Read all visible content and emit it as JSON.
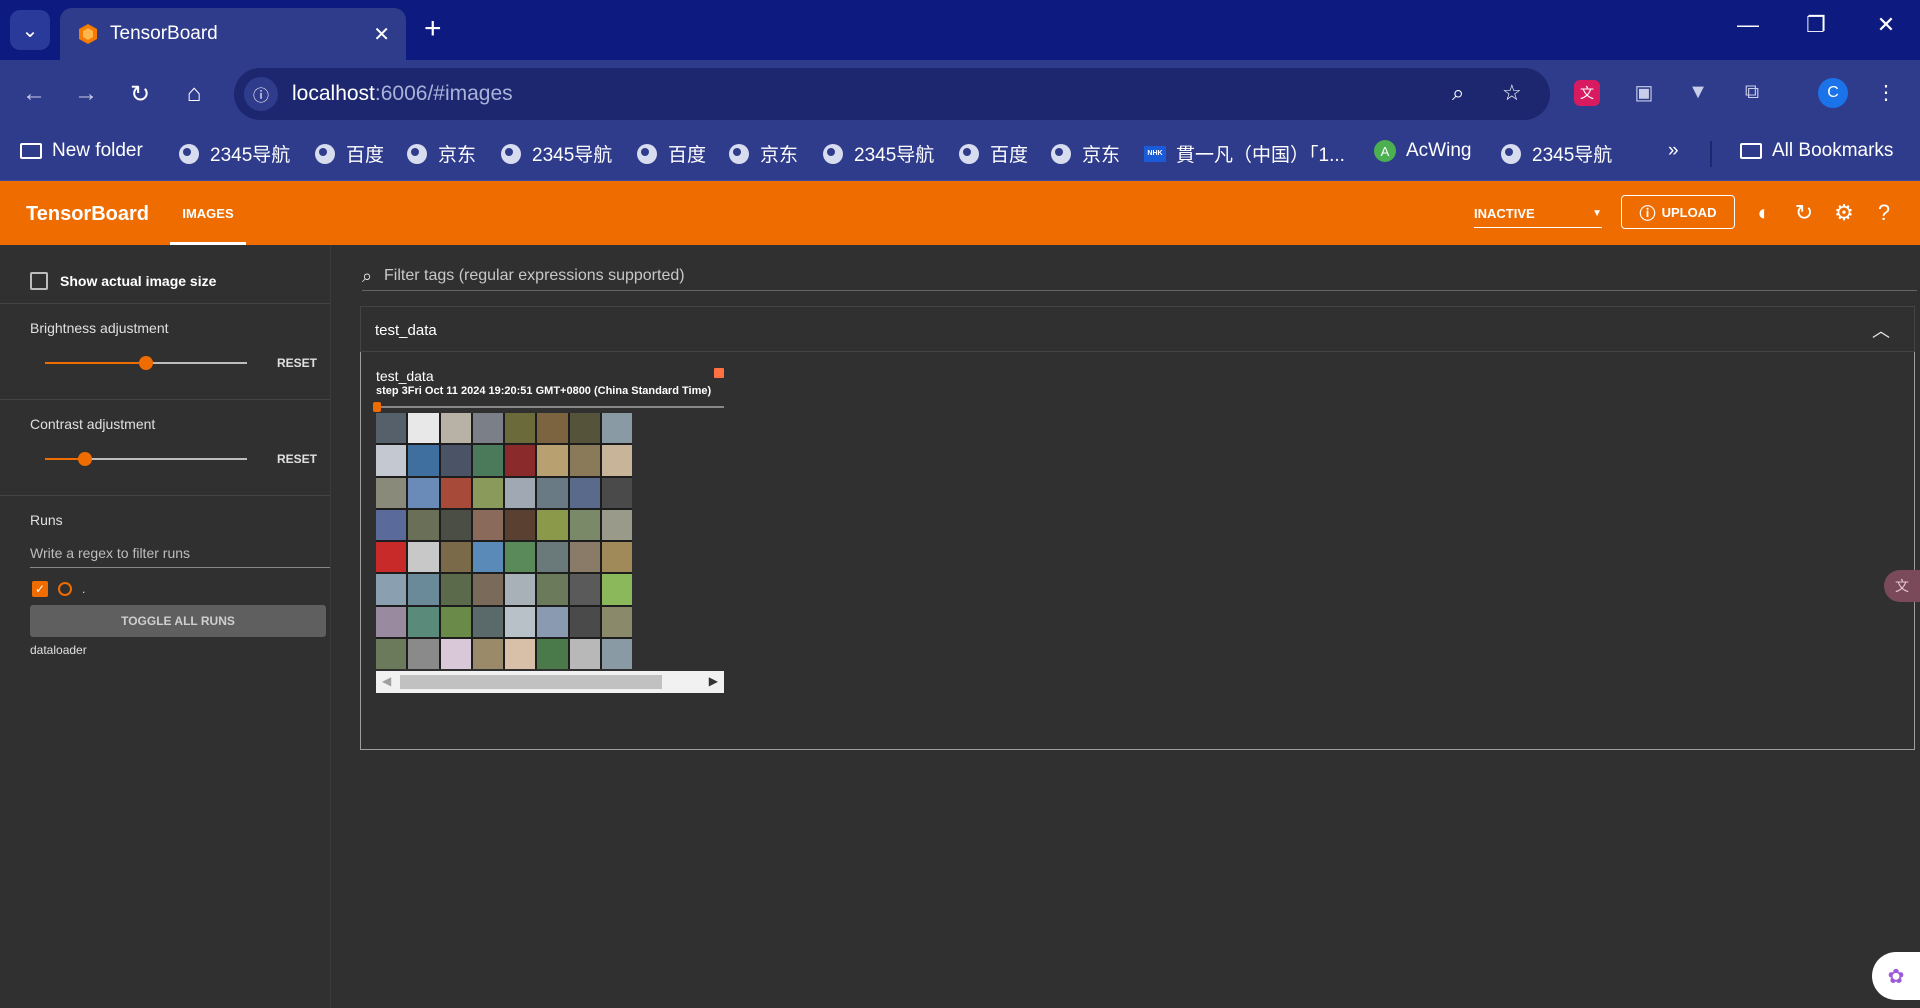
{
  "browser": {
    "tab_title": "TensorBoard",
    "url_host": "localhost",
    "url_path": ":6006/#images",
    "profile_initial": "C",
    "bookmarks": [
      {
        "label": "New folder",
        "icon": "folder-icon"
      },
      {
        "label": "2345导航",
        "icon": "globe-icon"
      },
      {
        "label": "百度",
        "icon": "globe-icon"
      },
      {
        "label": "京东",
        "icon": "globe-icon"
      },
      {
        "label": "2345导航",
        "icon": "globe-icon"
      },
      {
        "label": "百度",
        "icon": "globe-icon"
      },
      {
        "label": "京东",
        "icon": "globe-icon"
      },
      {
        "label": "2345导航",
        "icon": "globe-icon"
      },
      {
        "label": "百度",
        "icon": "globe-icon"
      },
      {
        "label": "京东",
        "icon": "globe-icon"
      },
      {
        "label": "貫一凡（中国）「1...",
        "icon": "nhk-icon"
      },
      {
        "label": "AcWing",
        "icon": "acwing-icon"
      },
      {
        "label": "2345导航",
        "icon": "globe-icon"
      }
    ],
    "overflow_label": "»",
    "all_bookmarks": "All Bookmarks"
  },
  "tensorboard": {
    "brand": "TensorBoard",
    "active_tab": "IMAGES",
    "status_select": "INACTIVE",
    "upload_label": "UPLOAD",
    "accent_color": "#ef6c00"
  },
  "sidebar": {
    "show_actual_size": "Show actual image size",
    "brightness_label": "Brightness adjustment",
    "brightness_value": 0.5,
    "contrast_label": "Contrast adjustment",
    "contrast_value": 0.2,
    "reset_label": "RESET",
    "runs_label": "Runs",
    "runs_filter_placeholder": "Write a regex to filter runs",
    "run_name": ".",
    "toggle_all": "TOGGLE ALL RUNS",
    "run_dir": "dataloader"
  },
  "main": {
    "filter_placeholder": "Filter tags (regular expressions supported)",
    "group_title": "test_data",
    "card": {
      "title": "test_data",
      "step_text": "step 3Fri Oct 11 2024 19:20:51 GMT+0800 (China Standard Time)"
    }
  },
  "image_tiles": [
    "#55606a",
    "#e8e8e8",
    "#b8b2a6",
    "#7a7f88",
    "#6b6a3a",
    "#7c6440",
    "#55533a",
    "#8a9aa4",
    "#c4c8d0",
    "#3f6f9e",
    "#4a5466",
    "#4a7a5a",
    "#8a2a2a",
    "#b8a070",
    "#8a7a5a",
    "#c8b498",
    "#8a8a7a",
    "#6a8ab8",
    "#a84a3a",
    "#8a9a5a",
    "#a0a8b4",
    "#6a7a84",
    "#5a6a8a",
    "#4a4a4a",
    "#5a6a9a",
    "#6a7058",
    "#4a4e44",
    "#8a6a5a",
    "#5a4030",
    "#8a9a4a",
    "#7a8a68",
    "#9a9a8a",
    "#c82a2a",
    "#c8c8c8",
    "#7a6a4a",
    "#5a8ab8",
    "#5a8a5a",
    "#6a7a7a",
    "#8a7a68",
    "#a08a5a",
    "#8aa0b0",
    "#6a8a9a",
    "#5a6a4a",
    "#7a6a5a",
    "#a8b0b8",
    "#6a7a5a",
    "#5a5a5a",
    "#8ab85a",
    "#9a8aa0",
    "#5a8a7a",
    "#6a8a4a",
    "#5a6a6a",
    "#b8c0c8",
    "#8a9ab0",
    "#4a4a4a",
    "#8a8a6a",
    "#6a7a5a",
    "#8a8a8a",
    "#d8c8d8",
    "#9a8a6a",
    "#d8c0a8",
    "#4a7a4a",
    "#b8b8b8",
    "#8a9aa4"
  ]
}
